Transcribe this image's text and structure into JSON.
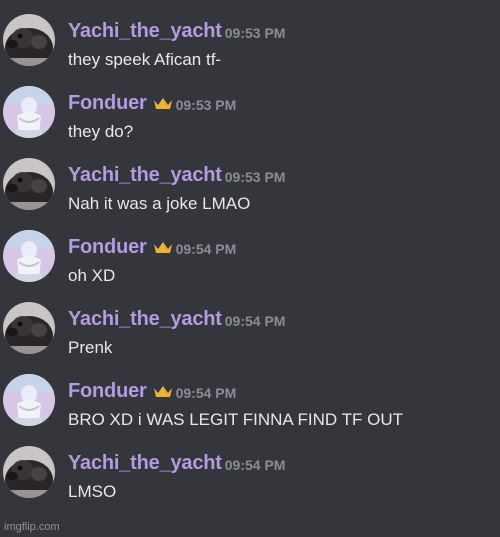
{
  "messages": [
    {
      "username": "Yachi_the_yacht",
      "time": "09:53 PM",
      "text": "they speek Afican tf-",
      "crown": false
    },
    {
      "username": "Fonduer",
      "time": "09:53 PM",
      "text": "they do?",
      "crown": true
    },
    {
      "username": "Yachi_the_yacht",
      "time": "09:53 PM",
      "text": "Nah it was a joke LMAO",
      "crown": false
    },
    {
      "username": "Fonduer",
      "time": "09:54 PM",
      "text": "oh XD",
      "crown": true
    },
    {
      "username": "Yachi_the_yacht",
      "time": "09:54 PM",
      "text": "Prenk",
      "crown": false
    },
    {
      "username": "Fonduer",
      "time": "09:54 PM",
      "text": "BRO XD i WAS LEGIT FINNA FIND TF OUT",
      "crown": true
    },
    {
      "username": "Yachi_the_yacht",
      "time": "09:54 PM",
      "text": "LMSO",
      "crown": false
    }
  ],
  "watermark": "imgflip.com",
  "colors": {
    "background": "#35363c",
    "username": "#b29bdf",
    "timestamp": "#8a8d93",
    "message_text": "#e8e8ea",
    "crown": "#f0b232"
  },
  "icons": {
    "crown": "crown-icon",
    "avatar_yachi": "dog-avatar",
    "avatar_fonduer": "statue-avatar"
  }
}
